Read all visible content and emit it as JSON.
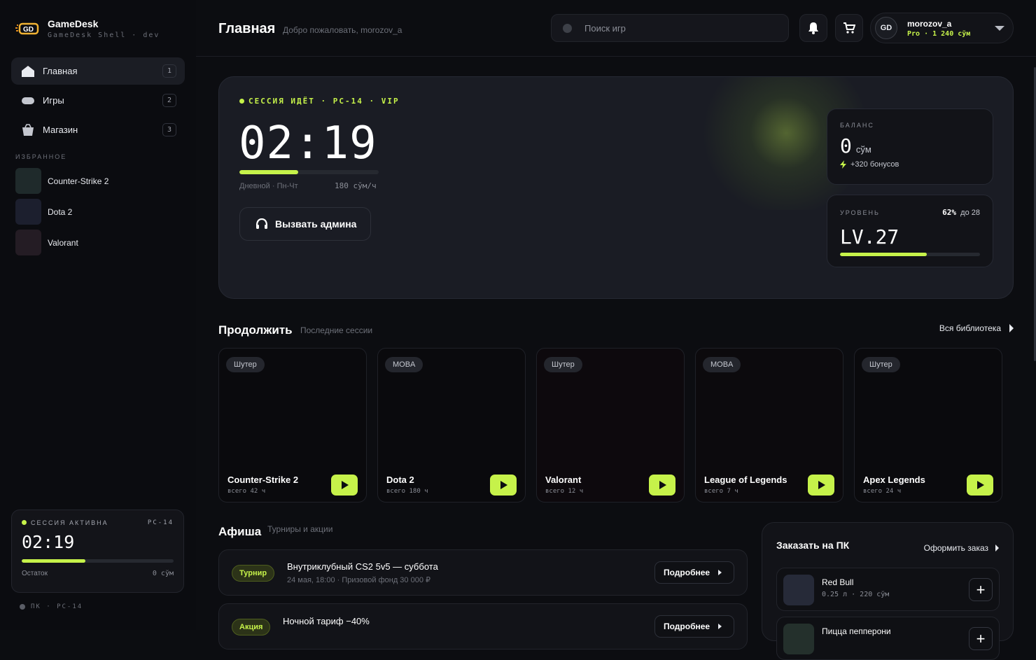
{
  "brand": {
    "title": "GameDesk",
    "subtitle": "GameDesk Shell · dev"
  },
  "nav": [
    {
      "label": "Главная",
      "count": "1",
      "icon": "home-icon",
      "active": true
    },
    {
      "label": "Игры",
      "count": "2",
      "icon": "gamepad-icon",
      "active": false
    },
    {
      "label": "Магазин",
      "count": "3",
      "icon": "shopping-bag-icon",
      "active": false
    }
  ],
  "favorites": {
    "heading": "ИЗБРАННОЕ",
    "items": [
      {
        "name": "Counter-Strike 2",
        "color": "#1f2a2b"
      },
      {
        "name": "Dota 2",
        "color": "#1c1f2e"
      },
      {
        "name": "Valorant",
        "color": "#241c24"
      }
    ]
  },
  "side_session": {
    "status": "СЕССИЯ АКТИВНА",
    "pc": "PC-14",
    "time": "02:19",
    "progress": 0.42,
    "remaining_label": "Остаток",
    "remaining_value": "0 сўм"
  },
  "pc_footer": "ПК · PC-14",
  "header": {
    "title": "Главная",
    "subtitle": "Добро пожаловать, morozov_a",
    "search_placeholder": "Поиск игр",
    "user": {
      "initials": "GD",
      "name": "morozov_a",
      "meta": "Pro · 1 240 сўм"
    }
  },
  "hero": {
    "status": "СЕССИЯ ИДЁТ · PC-14 · VIP",
    "time": "02:19",
    "progress": 0.42,
    "tariff": "Дневной · Пн-Чт",
    "rate": "180 сўм/ч",
    "call_admin": "Вызвать админа",
    "balance": {
      "label": "БАЛАНС",
      "value": "0",
      "currency": "сўм",
      "bonus": "+320 бонусов"
    },
    "level": {
      "label": "УРОВЕНЬ",
      "percent": "62%",
      "next": "до 28",
      "value": "LV.27",
      "progress": 0.62
    }
  },
  "continue": {
    "title": "Продолжить",
    "subtitle": "Последние сессии",
    "library_link": "Вся библиотека",
    "games": [
      {
        "tag": "Шутер",
        "name": "Counter-Strike 2",
        "hours": "всего 42 ч"
      },
      {
        "tag": "MOBA",
        "name": "Dota 2",
        "hours": "всего 180 ч"
      },
      {
        "tag": "Шутер",
        "name": "Valorant",
        "hours": "всего 12 ч"
      },
      {
        "tag": "MOBA",
        "name": "League of Legends",
        "hours": "всего 7 ч"
      },
      {
        "tag": "Шутер",
        "name": "Apex Legends",
        "hours": "всего 24 ч"
      }
    ]
  },
  "events": {
    "title": "Афиша",
    "subtitle": "Турниры и акции",
    "items": [
      {
        "badge": "Турнир",
        "title": "Внутриклубный CS2 5v5 — суббота",
        "meta": "24 мая, 18:00 · Призовой фонд 30 000 ₽",
        "button": "Подробнее"
      },
      {
        "badge": "Акция",
        "title": "Ночной тариф −40%",
        "meta": "",
        "button": "Подробнее"
      }
    ]
  },
  "order": {
    "title": "Заказать на ПК",
    "link": "Оформить заказ",
    "items": [
      {
        "name": "Red Bull",
        "meta": "0.25 л · 220 сўм",
        "color": "#262a38"
      },
      {
        "name": "Пицца пепперони",
        "meta": "",
        "color": "#24302c"
      }
    ]
  },
  "colors": {
    "accent": "#c6f24a",
    "background": "#0c0d11",
    "panel": "#1a1c24"
  }
}
